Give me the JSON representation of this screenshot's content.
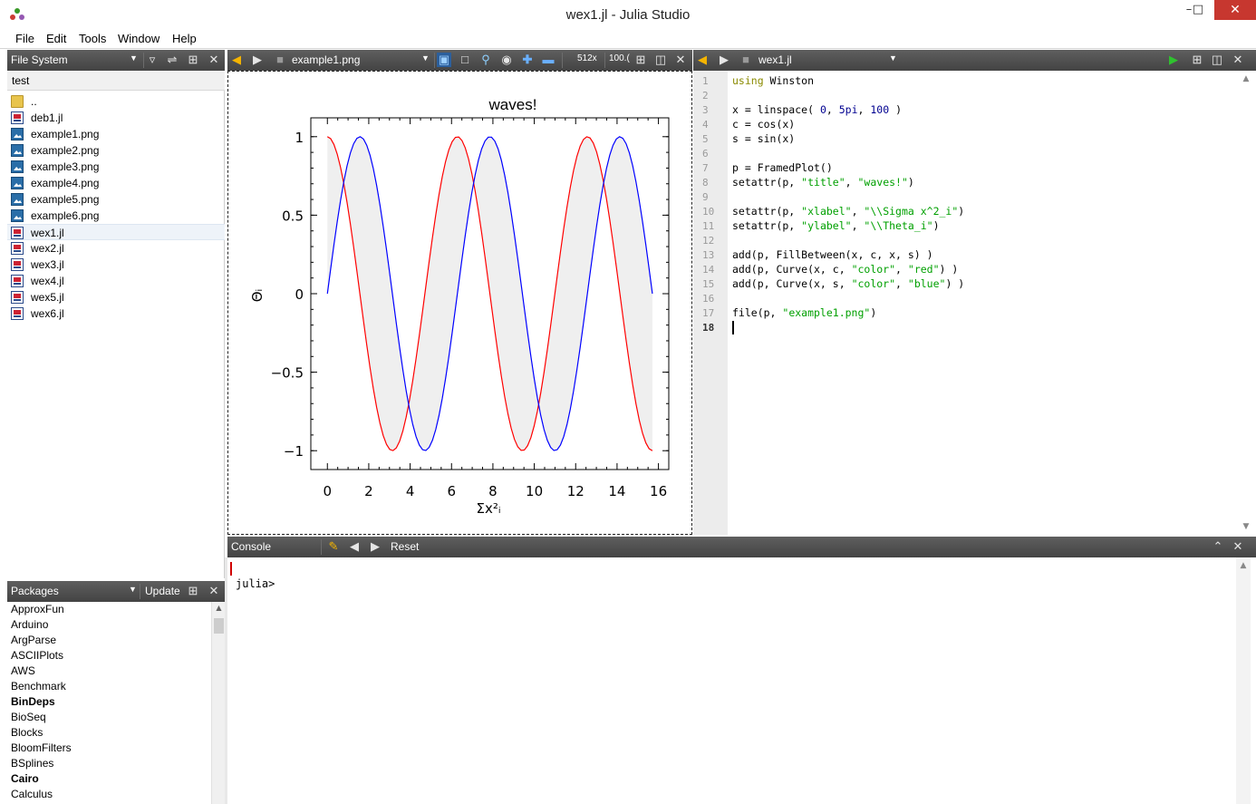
{
  "window": {
    "title": "wex1.jl - Julia Studio",
    "minimize": "–",
    "maximize": "□",
    "close": "✕"
  },
  "menu": [
    "File",
    "Edit",
    "Tools",
    "Window",
    "Help"
  ],
  "file_system": {
    "header": "File System",
    "folder": "test",
    "items": [
      {
        "name": "..",
        "type": "folder"
      },
      {
        "name": "deb1.jl",
        "type": "jl"
      },
      {
        "name": "example1.png",
        "type": "png"
      },
      {
        "name": "example2.png",
        "type": "png"
      },
      {
        "name": "example3.png",
        "type": "png"
      },
      {
        "name": "example4.png",
        "type": "png"
      },
      {
        "name": "example5.png",
        "type": "png"
      },
      {
        "name": "example6.png",
        "type": "png"
      },
      {
        "name": "wex1.jl",
        "type": "jl",
        "selected": true
      },
      {
        "name": "wex2.jl",
        "type": "jl"
      },
      {
        "name": "wex3.jl",
        "type": "jl"
      },
      {
        "name": "wex4.jl",
        "type": "jl"
      },
      {
        "name": "wex5.jl",
        "type": "jl"
      },
      {
        "name": "wex6.jl",
        "type": "jl"
      }
    ]
  },
  "image_viewer": {
    "file": "example1.png",
    "size_label": "512x",
    "zoom_label": "100.("
  },
  "editor": {
    "file": "wex1.jl",
    "current_line": 18
  },
  "packages": {
    "header": "Packages",
    "update_label": "Update",
    "items": [
      {
        "name": "ApproxFun",
        "bold": false
      },
      {
        "name": "Arduino",
        "bold": false
      },
      {
        "name": "ArgParse",
        "bold": false
      },
      {
        "name": "ASCIIPlots",
        "bold": false
      },
      {
        "name": "AWS",
        "bold": false
      },
      {
        "name": "Benchmark",
        "bold": false
      },
      {
        "name": "BinDeps",
        "bold": true
      },
      {
        "name": "BioSeq",
        "bold": false
      },
      {
        "name": "Blocks",
        "bold": false
      },
      {
        "name": "BloomFilters",
        "bold": false
      },
      {
        "name": "BSplines",
        "bold": false
      },
      {
        "name": "Cairo",
        "bold": true
      },
      {
        "name": "Calculus",
        "bold": false
      }
    ]
  },
  "console": {
    "header": "Console",
    "reset_label": "Reset",
    "prompt": "julia>"
  },
  "chart_data": {
    "type": "line",
    "title": "waves!",
    "xlabel": "Σx²ᵢ",
    "ylabel": "Θᵢ",
    "xlim": [
      -0.8,
      16.5
    ],
    "ylim": [
      -1.12,
      1.12
    ],
    "xticks": [
      0,
      2,
      4,
      6,
      8,
      10,
      12,
      14,
      16
    ],
    "xtick_labels": [
      "0",
      "2",
      "4",
      "6",
      "8",
      "10",
      "12",
      "14",
      "16"
    ],
    "yticks": [
      1,
      0.5,
      0,
      -0.5,
      -1
    ],
    "ytick_labels": [
      "1",
      "0.5",
      "0",
      "−0.5",
      "−1"
    ],
    "x_domain": [
      0,
      15.708
    ],
    "samples": 100,
    "fill_between": {
      "color": "#efefef"
    },
    "series": [
      {
        "values_fn": "cos",
        "color": "#ff0000"
      },
      {
        "values_fn": "sin",
        "color": "#0000ff"
      }
    ]
  }
}
